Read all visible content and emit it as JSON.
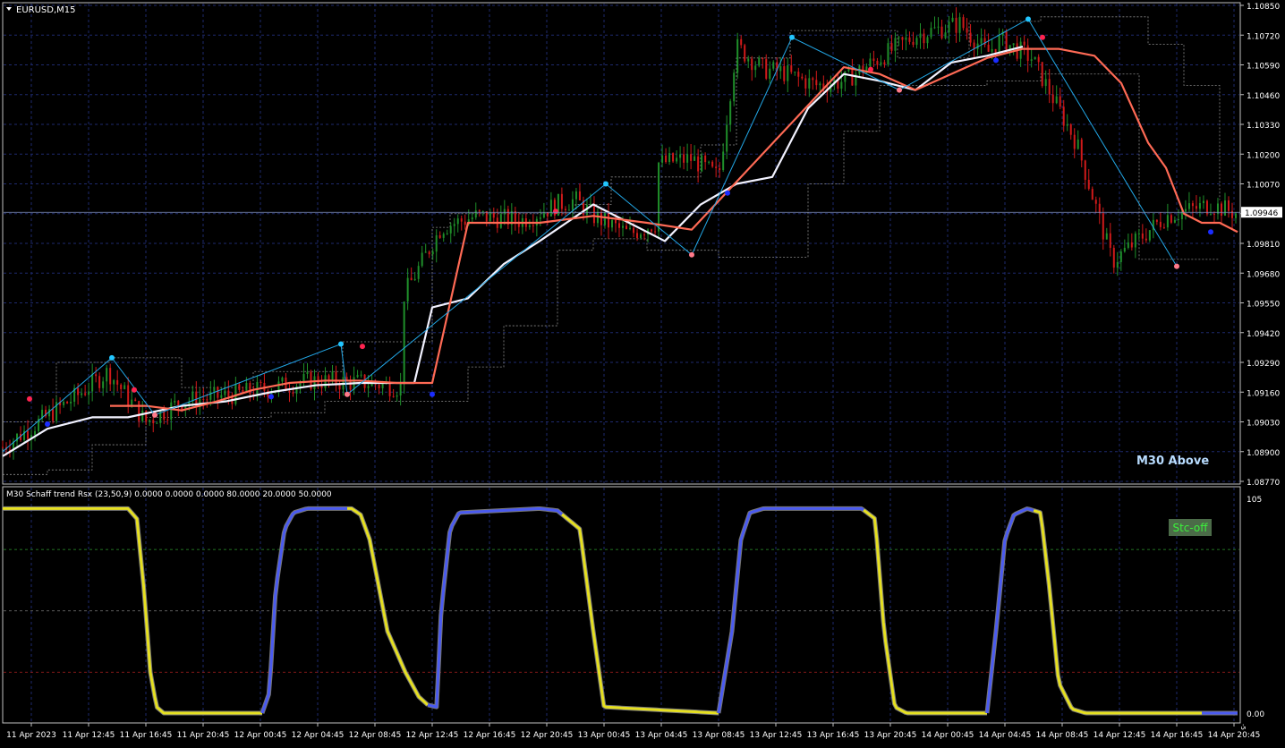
{
  "window": {
    "symbol_label": "EURUSD,M15"
  },
  "colors": {
    "background": "#000000",
    "grid": "#1e2a6e",
    "bull_candle": "#1f8f2a",
    "bear_candle": "#d11a1a",
    "zigzag": "#22a7e6",
    "ma_white": "#f2f2ff",
    "ma_salmon": "#ff6a55",
    "channel": "#8a8a8a",
    "dot_blue": "#1a2cff",
    "dot_red": "#ff2450",
    "dot_cyan": "#22c6ff",
    "dot_pink": "#ff7a8a",
    "stc_up": "#4a5af0",
    "stc_down": "#e6e020",
    "level_80": "#2e9a2e",
    "level_50": "#7a7a7a",
    "level_20": "#b02020",
    "axis_text": "#ffffff",
    "price_tag_bg": "#ffffff",
    "status_text": "#b8dcff",
    "stc_badge_bg": "#4b6b48",
    "stc_badge_text": "#3cf03c"
  },
  "main_panel": {
    "status_label": "M30 Above",
    "current_price": "1.09946"
  },
  "indicator_panel": {
    "header": "M30 Schaff trend Rsx (23,50,9) 0.0000 0.0000 0.0000 80.0000 20.0000 50.0000",
    "badge": "Stc-off",
    "scale_top": "105",
    "scale_bottom": "0.00",
    "scale_mini": "-5"
  },
  "chart_data": [
    {
      "type": "candlestick",
      "title": "EURUSD,M15",
      "y_ticks": [
        "1.10850",
        "1.10720",
        "1.10590",
        "1.10460",
        "1.10330",
        "1.10200",
        "1.10070",
        "1.09940",
        "1.09810",
        "1.09680",
        "1.09550",
        "1.09420",
        "1.09290",
        "1.09160",
        "1.09030",
        "1.08900",
        "1.08770"
      ],
      "ylim": [
        1.0877,
        1.1085
      ],
      "x_ticks": [
        "11 Apr 2023",
        "11 Apr 12:45",
        "11 Apr 16:45",
        "11 Apr 20:45",
        "12 Apr 00:45",
        "12 Apr 04:45",
        "12 Apr 08:45",
        "12 Apr 12:45",
        "12 Apr 16:45",
        "12 Apr 20:45",
        "13 Apr 00:45",
        "13 Apr 04:45",
        "13 Apr 08:45",
        "13 Apr 12:45",
        "13 Apr 16:45",
        "13 Apr 20:45",
        "14 Apr 00:45",
        "14 Apr 04:45",
        "14 Apr 08:45",
        "14 Apr 12:45",
        "14 Apr 16:45",
        "14 Apr 20:45"
      ],
      "series": [
        {
          "name": "price_path",
          "x": [
            0,
            0.085,
            0.118,
            0.16,
            0.2,
            0.26,
            0.33,
            0.345,
            0.41,
            0.445,
            0.445,
            0.49,
            0.53,
            0.58,
            0.62,
            0.64,
            0.66,
            0.7,
            0.73,
            0.73,
            0.77,
            0.8,
            0.82,
            0.85,
            0.87,
            0.91,
            0.94,
            0.98,
            1.02,
            1.07,
            1.1,
            1.115,
            1.15,
            1.2,
            1.24,
            1.3,
            1.35,
            1.38
          ],
          "y": [
            1.0892,
            1.0915,
            1.0925,
            1.0903,
            1.0912,
            1.0915,
            1.092,
            1.0921,
            1.092,
            1.0918,
            1.0956,
            1.0988,
            1.0993,
            1.0991,
            1.0998,
            1.1,
            1.0993,
            1.0985,
            1.099,
            1.1016,
            1.1018,
            1.101,
            1.1067,
            1.1057,
            1.1056,
            1.105,
            1.1052,
            1.1062,
            1.1072,
            1.1077,
            1.1064,
            1.107,
            1.1062,
            1.1025,
            1.0973,
            1.0993,
            1.0998,
            1.0994
          ]
        },
        {
          "name": "zigzag",
          "x": [
            0.0,
            0.122,
            0.17,
            0.378,
            0.385,
            0.674,
            0.77,
            0.882,
            1.002,
            1.146,
            1.312
          ],
          "y": [
            1.089,
            1.0931,
            1.0906,
            1.0937,
            1.0915,
            1.1007,
            1.0976,
            1.1071,
            1.1048,
            1.1079,
            1.0971
          ]
        },
        {
          "name": "ma_white",
          "x": [
            0,
            0.05,
            0.1,
            0.14,
            0.2,
            0.25,
            0.3,
            0.35,
            0.4,
            0.46,
            0.48,
            0.52,
            0.56,
            0.6,
            0.66,
            0.7,
            0.74,
            0.78,
            0.82,
            0.86,
            0.9,
            0.94,
            0.98,
            1.02,
            1.06,
            1.1,
            1.14
          ],
          "y": [
            1.0888,
            1.09,
            1.0905,
            1.0905,
            1.091,
            1.0912,
            1.0916,
            1.0919,
            1.092,
            1.092,
            1.0953,
            1.0957,
            1.0972,
            1.0982,
            1.0998,
            1.099,
            1.0982,
            1.0998,
            1.1007,
            1.101,
            1.104,
            1.1055,
            1.1052,
            1.1048,
            1.106,
            1.1063,
            1.1067
          ]
        },
        {
          "name": "ma_salmon",
          "x": [
            0.12,
            0.16,
            0.2,
            0.24,
            0.28,
            0.32,
            0.36,
            0.4,
            0.44,
            0.48,
            0.52,
            0.6,
            0.66,
            0.72,
            0.77,
            0.94,
            0.98,
            1.02,
            1.06,
            1.1,
            1.14,
            1.18,
            1.22,
            1.25,
            1.28,
            1.3,
            1.32,
            1.34,
            1.36,
            1.38
          ],
          "y": [
            1.091,
            1.091,
            1.0908,
            1.0912,
            1.0917,
            1.092,
            1.0921,
            1.0921,
            1.092,
            1.092,
            1.099,
            1.099,
            1.0993,
            1.099,
            1.0987,
            1.1058,
            1.1055,
            1.1048,
            1.1055,
            1.1062,
            1.1066,
            1.1066,
            1.1063,
            1.1051,
            1.1025,
            1.1014,
            1.0994,
            1.099,
            1.099,
            1.0986
          ]
        },
        {
          "name": "channel_upper",
          "x": [
            0,
            0.06,
            0.12,
            0.2,
            0.28,
            0.38,
            0.44,
            0.48,
            0.5,
            0.56,
            0.64,
            0.68,
            0.74,
            0.78,
            0.82,
            0.88,
            0.96,
            1.0,
            1.08,
            1.16,
            1.24,
            1.28,
            1.32,
            1.36
          ],
          "y": [
            1.0903,
            1.0929,
            1.0931,
            1.0918,
            1.0925,
            1.0938,
            1.0938,
            1.0988,
            1.0994,
            1.0994,
            1.0998,
            1.101,
            1.101,
            1.1024,
            1.1062,
            1.1074,
            1.1074,
            1.1062,
            1.1078,
            1.108,
            1.108,
            1.1068,
            1.105,
            1.1
          ]
        },
        {
          "name": "channel_lower",
          "x": [
            0,
            0.05,
            0.1,
            0.16,
            0.2,
            0.26,
            0.3,
            0.36,
            0.44,
            0.5,
            0.52,
            0.56,
            0.62,
            0.66,
            0.72,
            0.8,
            0.86,
            0.9,
            0.94,
            0.98,
            1.06,
            1.1,
            1.16,
            1.22,
            1.27,
            1.31,
            1.36
          ],
          "y": [
            1.088,
            1.0882,
            1.0893,
            1.0905,
            1.0905,
            1.0905,
            1.0907,
            1.0912,
            1.0912,
            1.0912,
            1.0927,
            1.0945,
            1.0978,
            1.0983,
            1.0978,
            1.0975,
            1.0975,
            1.1007,
            1.103,
            1.105,
            1.105,
            1.1052,
            1.1055,
            1.1055,
            1.0974,
            1.0974,
            1.0974
          ]
        }
      ],
      "marker_series": [
        {
          "name": "blue_dots",
          "x": [
            0.05,
            0.3,
            0.48,
            0.81,
            1.11,
            1.35
          ],
          "y": [
            1.0902,
            1.0914,
            1.0915,
            1.1003,
            1.1061,
            1.0986
          ]
        },
        {
          "name": "red_dots",
          "x": [
            0.03,
            0.147,
            0.402,
            0.618,
            0.97,
            1.162
          ],
          "y": [
            1.0913,
            1.0917,
            1.0936,
            1.0995,
            1.1057,
            1.1071
          ]
        },
        {
          "name": "cyan_dots",
          "x": [
            0.122,
            0.378,
            0.674,
            0.882,
            1.146
          ],
          "y": [
            1.0931,
            1.0937,
            1.1007,
            1.1071,
            1.1079
          ]
        },
        {
          "name": "pink_dots",
          "x": [
            0.17,
            0.385,
            0.77,
            1.002,
            1.312
          ],
          "y": [
            1.0906,
            1.0915,
            1.0976,
            1.1048,
            1.0971
          ]
        }
      ]
    },
    {
      "type": "line",
      "title": "M30 Schaff trend Rsx (23,50,9) 0.0000 0.0000 0.0000 80.0000 20.0000 50.0000",
      "ylim": [
        0,
        105
      ],
      "levels": [
        80,
        50,
        20
      ],
      "series": [
        {
          "name": "stc",
          "x": [
            0,
            0.14,
            0.15,
            0.158,
            0.165,
            0.172,
            0.18,
            0.29,
            0.298,
            0.305,
            0.315,
            0.325,
            0.34,
            0.39,
            0.4,
            0.41,
            0.43,
            0.45,
            0.465,
            0.475,
            0.485,
            0.49,
            0.5,
            0.51,
            0.6,
            0.62,
            0.645,
            0.66,
            0.672,
            0.8,
            0.815,
            0.825,
            0.835,
            0.85,
            0.96,
            0.975,
            0.985,
            0.997,
            1.01,
            1.1,
            1.11,
            1.12,
            1.13,
            1.145,
            1.16,
            1.17,
            1.18,
            1.195,
            1.21,
            1.34,
            1.38
          ],
          "y": [
            100,
            100,
            95,
            60,
            20,
            3,
            0,
            0,
            10,
            60,
            90,
            98,
            100,
            100,
            97,
            85,
            40,
            20,
            8,
            4,
            3,
            50,
            90,
            98,
            100,
            99,
            90,
            40,
            3,
            0,
            40,
            85,
            98,
            100,
            100,
            95,
            40,
            3,
            0,
            0,
            40,
            85,
            97,
            100,
            98,
            60,
            15,
            2,
            0,
            0,
            0
          ]
        }
      ],
      "up_segments": [
        [
          0.29,
          0.385
        ],
        [
          0.475,
          0.625
        ],
        [
          0.8,
          0.962
        ],
        [
          1.1,
          1.152
        ],
        [
          1.34,
          1.38
        ]
      ],
      "down_segments": [
        [
          0.0,
          0.29
        ],
        [
          0.385,
          0.475
        ],
        [
          0.625,
          0.8
        ],
        [
          0.962,
          1.1
        ],
        [
          1.152,
          1.34
        ]
      ]
    }
  ]
}
